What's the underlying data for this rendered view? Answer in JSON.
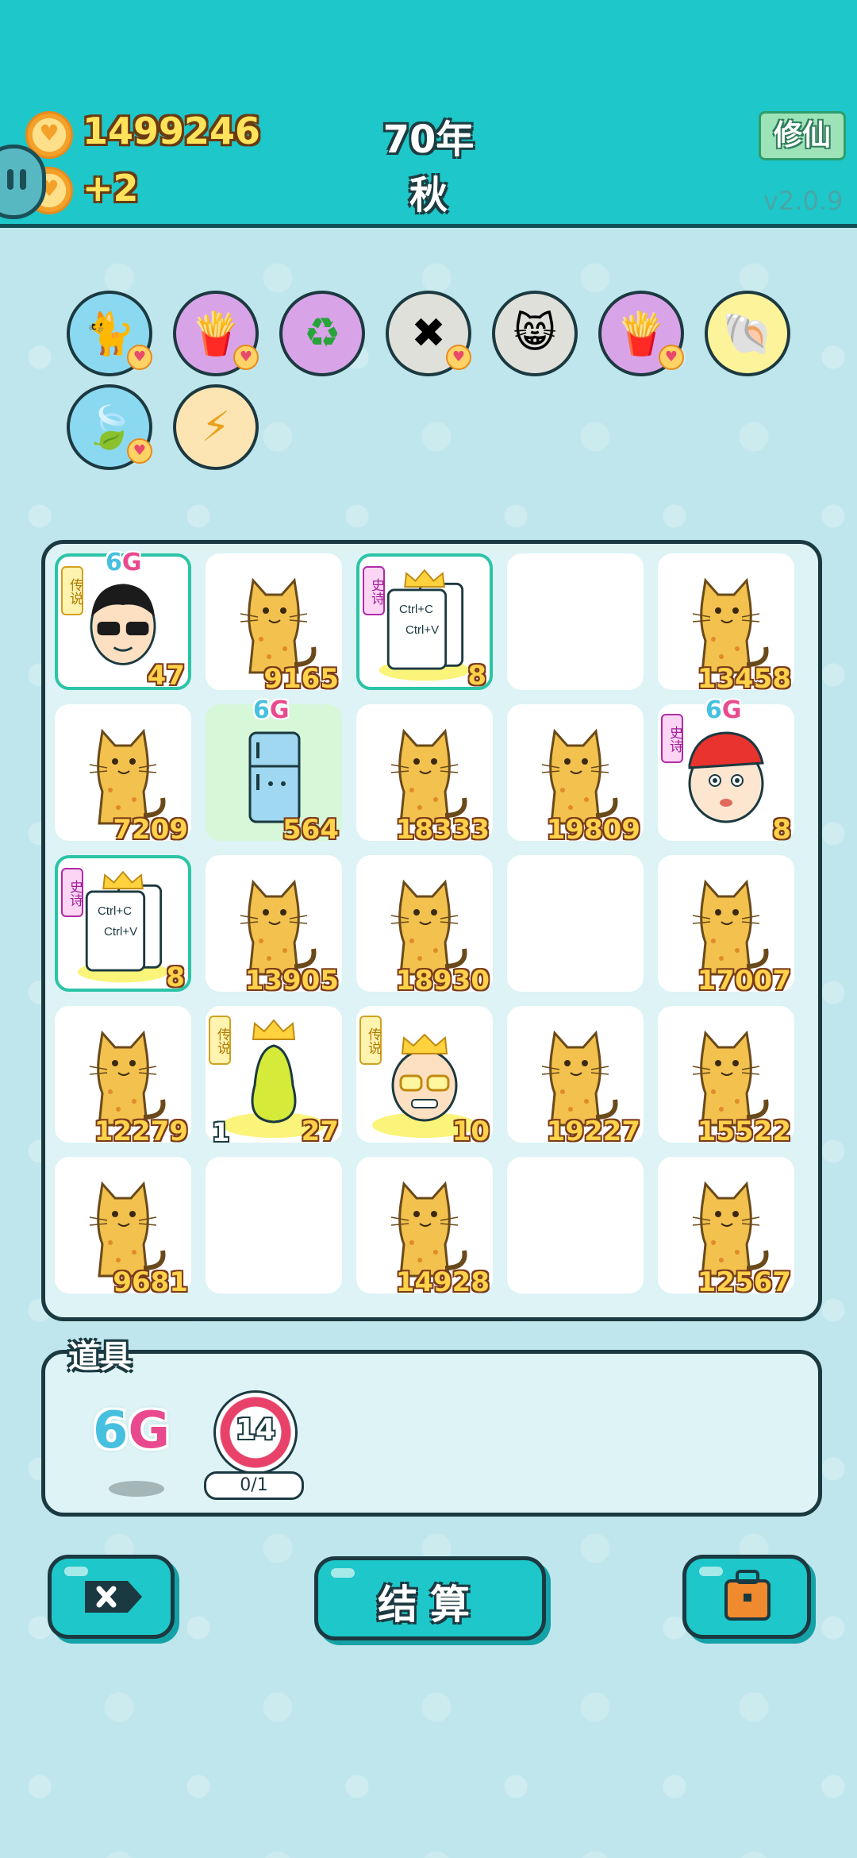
{
  "header": {
    "coins": "1499246",
    "coin_rate": "+2",
    "year": "70年",
    "season": "秋",
    "mode_button": "修仙",
    "version": "v2.0.9"
  },
  "buffs": [
    {
      "icon": "cat-silhouette-icon",
      "bg": "#8bd9f0",
      "heart": true
    },
    {
      "icon": "fries-icon",
      "bg": "#d9a3e8",
      "heart": true
    },
    {
      "icon": "recycle-icon",
      "bg": "#d9a3e8",
      "heart": false
    },
    {
      "icon": "delete-tag-icon",
      "bg": "#e0e0da",
      "heart": true
    },
    {
      "icon": "cat-faces-icon",
      "bg": "#e0e0da",
      "heart": false
    },
    {
      "icon": "fries-icon",
      "bg": "#d9a3e8",
      "heart": true
    },
    {
      "icon": "shell-icon",
      "bg": "#fdf39a",
      "heart": false
    },
    {
      "icon": "leaf-icon",
      "bg": "#8bd9f0",
      "heart": true
    },
    {
      "icon": "lightning-icon",
      "bg": "#fde4b3",
      "heart": false
    }
  ],
  "board": {
    "cells": [
      {
        "item": "sunglasses-man",
        "value": "47",
        "tag": "传说",
        "tag_type": "cs",
        "g6": true,
        "hl": true
      },
      {
        "item": "cat",
        "value": "9165"
      },
      {
        "item": "ctrl-cv-card",
        "value": "8",
        "tag": "史诗",
        "tag_type": "ss",
        "hl": true,
        "card_text": [
          "Ctrl+C",
          "Ctrl+V"
        ]
      },
      {
        "item": "empty"
      },
      {
        "item": "cat",
        "value": "13458"
      },
      {
        "item": "cat",
        "value": "7209"
      },
      {
        "item": "fridge",
        "value": "564",
        "g6": true,
        "green": true
      },
      {
        "item": "cat",
        "value": "18333"
      },
      {
        "item": "cat",
        "value": "19809"
      },
      {
        "item": "red-hat-boy",
        "value": "8",
        "tag": "史诗",
        "tag_type": "ss",
        "g6": true
      },
      {
        "item": "ctrl-cv-card",
        "value": "8",
        "tag": "史诗",
        "tag_type": "ss",
        "hl": true,
        "card_text": [
          "Ctrl+C",
          "Ctrl+V"
        ]
      },
      {
        "item": "cat",
        "value": "13905"
      },
      {
        "item": "cat",
        "value": "18930"
      },
      {
        "item": "empty"
      },
      {
        "item": "cat",
        "value": "17007"
      },
      {
        "item": "cat",
        "value": "12279"
      },
      {
        "item": "pear",
        "value": "27",
        "level": "1",
        "tag": "传说",
        "tag_type": "cs"
      },
      {
        "item": "crown-grandpa",
        "value": "10",
        "tag": "传说",
        "tag_type": "cs"
      },
      {
        "item": "cat",
        "value": "19227"
      },
      {
        "item": "cat",
        "value": "15522"
      },
      {
        "item": "cat",
        "value": "9681"
      },
      {
        "item": "empty"
      },
      {
        "item": "cat",
        "value": "14928"
      },
      {
        "item": "empty"
      },
      {
        "item": "cat",
        "value": "12567"
      }
    ]
  },
  "tools": {
    "label": "道具",
    "g6_text_a": "6",
    "g6_text_b": "G",
    "target_value": "14",
    "target_progress": "0/1"
  },
  "cell_g6": {
    "a": "6",
    "b": "G"
  },
  "bottom": {
    "settle_label": "结算"
  }
}
